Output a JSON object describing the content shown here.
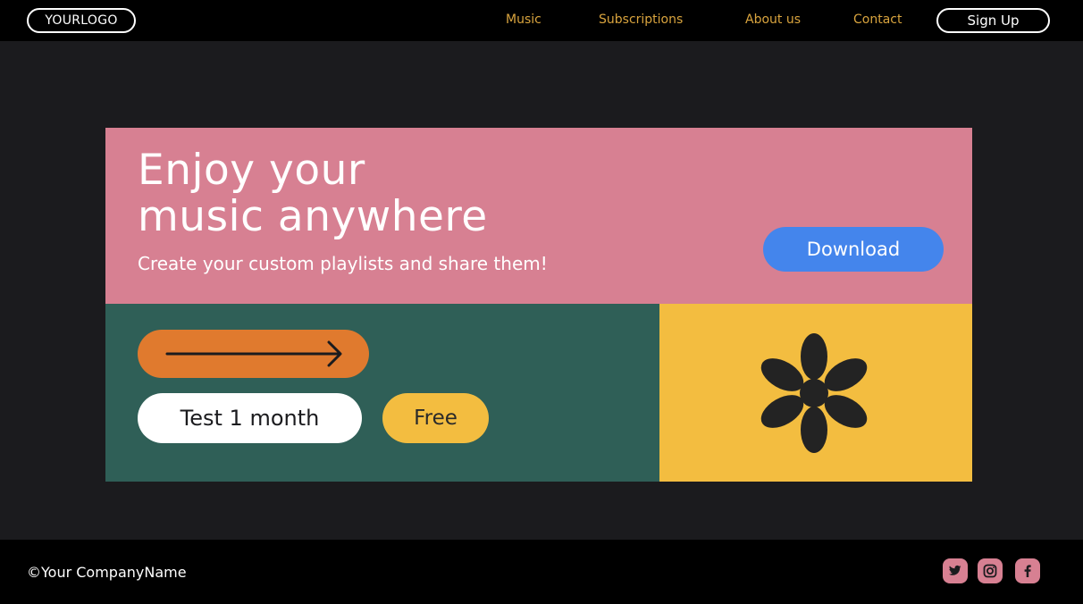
{
  "header": {
    "logo": "YOURLOGO",
    "nav": [
      {
        "label": "Music"
      },
      {
        "label": "Subscriptions"
      },
      {
        "label": "About us"
      },
      {
        "label": "Contact"
      }
    ],
    "signup_label": "Sign Up"
  },
  "hero": {
    "title_line1": "Enjoy your",
    "title_line2": "music anywhere",
    "subtitle": "Create your custom playlists and share them!",
    "download_label": "Download"
  },
  "offer": {
    "arrow_icon": "arrow-right-icon",
    "trial_label": "Test 1 month",
    "free_label": "Free"
  },
  "decor": {
    "asterisk_icon": "asterisk-icon"
  },
  "footer": {
    "copyright": "©Your CompanyName",
    "social": [
      "twitter-icon",
      "instagram-icon",
      "facebook-icon"
    ]
  },
  "colors": {
    "page_bg": "#1b1b1e",
    "bar_bg": "#000000",
    "nav_text": "#d9a43e",
    "pink": "#d78092",
    "blue": "#4485ec",
    "green": "#2f5f57",
    "orange": "#e07a2e",
    "yellow": "#f3bd40"
  }
}
